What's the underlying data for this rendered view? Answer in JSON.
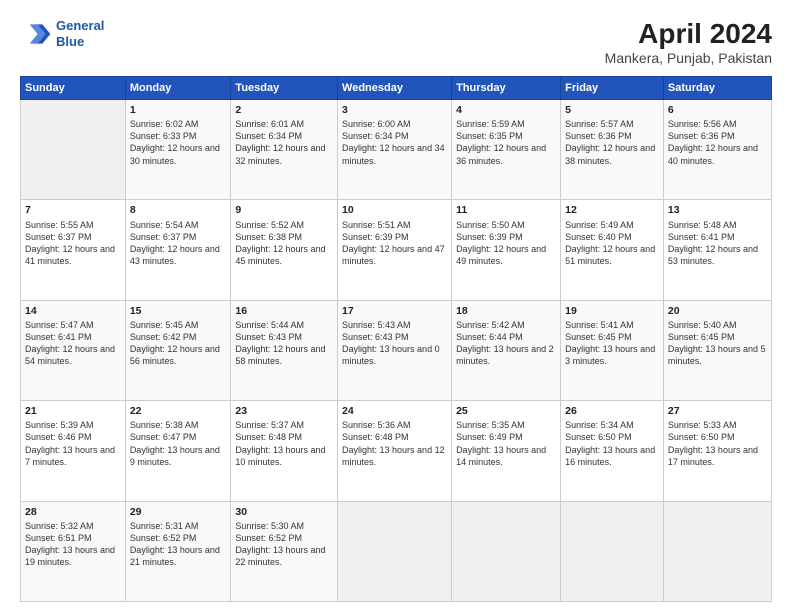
{
  "logo": {
    "line1": "General",
    "line2": "Blue"
  },
  "title": "April 2024",
  "subtitle": "Mankera, Punjab, Pakistan",
  "header_days": [
    "Sunday",
    "Monday",
    "Tuesday",
    "Wednesday",
    "Thursday",
    "Friday",
    "Saturday"
  ],
  "weeks": [
    [
      {
        "day": "",
        "sunrise": "",
        "sunset": "",
        "daylight": ""
      },
      {
        "day": "1",
        "sunrise": "Sunrise: 6:02 AM",
        "sunset": "Sunset: 6:33 PM",
        "daylight": "Daylight: 12 hours and 30 minutes."
      },
      {
        "day": "2",
        "sunrise": "Sunrise: 6:01 AM",
        "sunset": "Sunset: 6:34 PM",
        "daylight": "Daylight: 12 hours and 32 minutes."
      },
      {
        "day": "3",
        "sunrise": "Sunrise: 6:00 AM",
        "sunset": "Sunset: 6:34 PM",
        "daylight": "Daylight: 12 hours and 34 minutes."
      },
      {
        "day": "4",
        "sunrise": "Sunrise: 5:59 AM",
        "sunset": "Sunset: 6:35 PM",
        "daylight": "Daylight: 12 hours and 36 minutes."
      },
      {
        "day": "5",
        "sunrise": "Sunrise: 5:57 AM",
        "sunset": "Sunset: 6:36 PM",
        "daylight": "Daylight: 12 hours and 38 minutes."
      },
      {
        "day": "6",
        "sunrise": "Sunrise: 5:56 AM",
        "sunset": "Sunset: 6:36 PM",
        "daylight": "Daylight: 12 hours and 40 minutes."
      }
    ],
    [
      {
        "day": "7",
        "sunrise": "Sunrise: 5:55 AM",
        "sunset": "Sunset: 6:37 PM",
        "daylight": "Daylight: 12 hours and 41 minutes."
      },
      {
        "day": "8",
        "sunrise": "Sunrise: 5:54 AM",
        "sunset": "Sunset: 6:37 PM",
        "daylight": "Daylight: 12 hours and 43 minutes."
      },
      {
        "day": "9",
        "sunrise": "Sunrise: 5:52 AM",
        "sunset": "Sunset: 6:38 PM",
        "daylight": "Daylight: 12 hours and 45 minutes."
      },
      {
        "day": "10",
        "sunrise": "Sunrise: 5:51 AM",
        "sunset": "Sunset: 6:39 PM",
        "daylight": "Daylight: 12 hours and 47 minutes."
      },
      {
        "day": "11",
        "sunrise": "Sunrise: 5:50 AM",
        "sunset": "Sunset: 6:39 PM",
        "daylight": "Daylight: 12 hours and 49 minutes."
      },
      {
        "day": "12",
        "sunrise": "Sunrise: 5:49 AM",
        "sunset": "Sunset: 6:40 PM",
        "daylight": "Daylight: 12 hours and 51 minutes."
      },
      {
        "day": "13",
        "sunrise": "Sunrise: 5:48 AM",
        "sunset": "Sunset: 6:41 PM",
        "daylight": "Daylight: 12 hours and 53 minutes."
      }
    ],
    [
      {
        "day": "14",
        "sunrise": "Sunrise: 5:47 AM",
        "sunset": "Sunset: 6:41 PM",
        "daylight": "Daylight: 12 hours and 54 minutes."
      },
      {
        "day": "15",
        "sunrise": "Sunrise: 5:45 AM",
        "sunset": "Sunset: 6:42 PM",
        "daylight": "Daylight: 12 hours and 56 minutes."
      },
      {
        "day": "16",
        "sunrise": "Sunrise: 5:44 AM",
        "sunset": "Sunset: 6:43 PM",
        "daylight": "Daylight: 12 hours and 58 minutes."
      },
      {
        "day": "17",
        "sunrise": "Sunrise: 5:43 AM",
        "sunset": "Sunset: 6:43 PM",
        "daylight": "Daylight: 13 hours and 0 minutes."
      },
      {
        "day": "18",
        "sunrise": "Sunrise: 5:42 AM",
        "sunset": "Sunset: 6:44 PM",
        "daylight": "Daylight: 13 hours and 2 minutes."
      },
      {
        "day": "19",
        "sunrise": "Sunrise: 5:41 AM",
        "sunset": "Sunset: 6:45 PM",
        "daylight": "Daylight: 13 hours and 3 minutes."
      },
      {
        "day": "20",
        "sunrise": "Sunrise: 5:40 AM",
        "sunset": "Sunset: 6:45 PM",
        "daylight": "Daylight: 13 hours and 5 minutes."
      }
    ],
    [
      {
        "day": "21",
        "sunrise": "Sunrise: 5:39 AM",
        "sunset": "Sunset: 6:46 PM",
        "daylight": "Daylight: 13 hours and 7 minutes."
      },
      {
        "day": "22",
        "sunrise": "Sunrise: 5:38 AM",
        "sunset": "Sunset: 6:47 PM",
        "daylight": "Daylight: 13 hours and 9 minutes."
      },
      {
        "day": "23",
        "sunrise": "Sunrise: 5:37 AM",
        "sunset": "Sunset: 6:48 PM",
        "daylight": "Daylight: 13 hours and 10 minutes."
      },
      {
        "day": "24",
        "sunrise": "Sunrise: 5:36 AM",
        "sunset": "Sunset: 6:48 PM",
        "daylight": "Daylight: 13 hours and 12 minutes."
      },
      {
        "day": "25",
        "sunrise": "Sunrise: 5:35 AM",
        "sunset": "Sunset: 6:49 PM",
        "daylight": "Daylight: 13 hours and 14 minutes."
      },
      {
        "day": "26",
        "sunrise": "Sunrise: 5:34 AM",
        "sunset": "Sunset: 6:50 PM",
        "daylight": "Daylight: 13 hours and 16 minutes."
      },
      {
        "day": "27",
        "sunrise": "Sunrise: 5:33 AM",
        "sunset": "Sunset: 6:50 PM",
        "daylight": "Daylight: 13 hours and 17 minutes."
      }
    ],
    [
      {
        "day": "28",
        "sunrise": "Sunrise: 5:32 AM",
        "sunset": "Sunset: 6:51 PM",
        "daylight": "Daylight: 13 hours and 19 minutes."
      },
      {
        "day": "29",
        "sunrise": "Sunrise: 5:31 AM",
        "sunset": "Sunset: 6:52 PM",
        "daylight": "Daylight: 13 hours and 21 minutes."
      },
      {
        "day": "30",
        "sunrise": "Sunrise: 5:30 AM",
        "sunset": "Sunset: 6:52 PM",
        "daylight": "Daylight: 13 hours and 22 minutes."
      },
      {
        "day": "",
        "sunrise": "",
        "sunset": "",
        "daylight": ""
      },
      {
        "day": "",
        "sunrise": "",
        "sunset": "",
        "daylight": ""
      },
      {
        "day": "",
        "sunrise": "",
        "sunset": "",
        "daylight": ""
      },
      {
        "day": "",
        "sunrise": "",
        "sunset": "",
        "daylight": ""
      }
    ]
  ]
}
